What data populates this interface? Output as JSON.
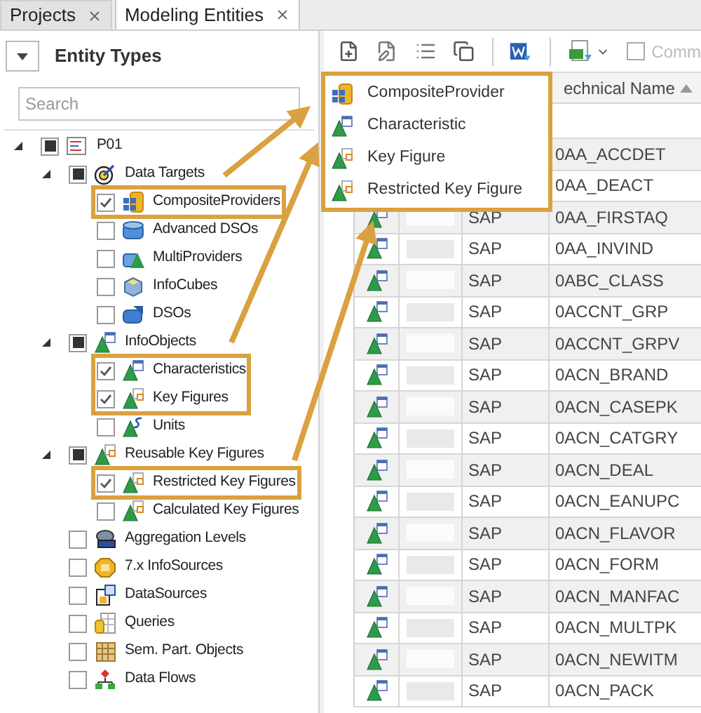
{
  "tabs": [
    {
      "label": "Projects",
      "selected": false
    },
    {
      "label": "Modeling Entities",
      "selected": true
    }
  ],
  "entity_panel": {
    "title": "Entity Types",
    "search": {
      "placeholder": "Search"
    }
  },
  "tree": [
    {
      "label": "P01",
      "kind": "project",
      "checked": false,
      "partial": true,
      "expanded": true,
      "highlighted": false,
      "children": [
        {
          "label": "Data Targets",
          "kind": "targets",
          "checked": false,
          "partial": true,
          "expanded": true,
          "highlighted": false,
          "children": [
            {
              "label": "CompositeProviders",
              "kind": "composite",
              "checked": true,
              "partial": false,
              "highlighted": true
            },
            {
              "label": "Advanced DSOs",
              "kind": "cylinder",
              "checked": false,
              "partial": false,
              "highlighted": false
            },
            {
              "label": "MultiProviders",
              "kind": "multi",
              "checked": false,
              "partial": false,
              "highlighted": false
            },
            {
              "label": "InfoCubes",
              "kind": "cube",
              "checked": false,
              "partial": false,
              "highlighted": false
            },
            {
              "label": "DSOs",
              "kind": "dso",
              "checked": false,
              "partial": false,
              "highlighted": false
            }
          ]
        },
        {
          "label": "InfoObjects",
          "kind": "characteristic",
          "checked": false,
          "partial": true,
          "expanded": true,
          "highlighted": false,
          "children": [
            {
              "label": "Characteristics",
              "kind": "characteristic",
              "checked": true,
              "partial": false,
              "highlighted": true
            },
            {
              "label": "Key Figures",
              "kind": "keyfigure",
              "checked": true,
              "partial": false,
              "highlighted": true
            },
            {
              "label": "Units",
              "kind": "unit",
              "checked": false,
              "partial": false,
              "highlighted": false
            }
          ]
        },
        {
          "label": "Reusable Key Figures",
          "kind": "keyfigure",
          "checked": false,
          "partial": true,
          "expanded": true,
          "highlighted": false,
          "children": [
            {
              "label": "Restricted Key Figures",
              "kind": "keyfigure",
              "checked": true,
              "partial": false,
              "highlighted": true
            },
            {
              "label": "Calculated Key Figures",
              "kind": "calculated",
              "checked": false,
              "partial": false,
              "highlighted": false
            }
          ]
        },
        {
          "label": "Aggregation Levels",
          "kind": "aggregation",
          "checked": false,
          "partial": false,
          "highlighted": false
        },
        {
          "label": "7.x InfoSources",
          "kind": "infosource",
          "checked": false,
          "partial": false,
          "highlighted": false
        },
        {
          "label": "DataSources",
          "kind": "datasource",
          "checked": false,
          "partial": false,
          "highlighted": false
        },
        {
          "label": "Queries",
          "kind": "query",
          "checked": false,
          "partial": false,
          "highlighted": false
        },
        {
          "label": "Sem. Part. Objects",
          "kind": "sempart",
          "checked": false,
          "partial": false,
          "highlighted": false
        },
        {
          "label": "Data Flows",
          "kind": "dataflow",
          "checked": false,
          "partial": false,
          "highlighted": false
        }
      ]
    }
  ],
  "toolbar": {
    "checkbox": {
      "label": "Comm",
      "checked": false
    }
  },
  "popup_menu": {
    "items": [
      {
        "label": "CompositeProvider",
        "kind": "composite"
      },
      {
        "label": "Characteristic",
        "kind": "characteristic"
      },
      {
        "label": "Key Figure",
        "kind": "keyfigure"
      },
      {
        "label": "Restricted Key Figure",
        "kind": "keyfigure"
      }
    ]
  },
  "table": {
    "columns": [
      {
        "label": "echnical Name",
        "sorted": true
      }
    ],
    "rows": [
      {
        "name": "0AA_ACCDET"
      },
      {
        "name": "0AA_DEACT"
      },
      {
        "owner": "SAP",
        "name": "0AA_FIRSTAQ"
      },
      {
        "owner": "SAP",
        "name": "0AA_INVIND"
      },
      {
        "owner": "SAP",
        "name": "0ABC_CLASS"
      },
      {
        "owner": "SAP",
        "name": "0ACCNT_GRP"
      },
      {
        "owner": "SAP",
        "name": "0ACCNT_GRPV"
      },
      {
        "owner": "SAP",
        "name": "0ACN_BRAND"
      },
      {
        "owner": "SAP",
        "name": "0ACN_CASEPK"
      },
      {
        "owner": "SAP",
        "name": "0ACN_CATGRY"
      },
      {
        "owner": "SAP",
        "name": "0ACN_DEAL"
      },
      {
        "owner": "SAP",
        "name": "0ACN_EANUPC"
      },
      {
        "owner": "SAP",
        "name": "0ACN_FLAVOR"
      },
      {
        "owner": "SAP",
        "name": "0ACN_FORM"
      },
      {
        "owner": "SAP",
        "name": "0ACN_MANFAC"
      },
      {
        "owner": "SAP",
        "name": "0ACN_MULTPK"
      },
      {
        "owner": "SAP",
        "name": "0ACN_NEWITM"
      },
      {
        "owner": "SAP",
        "name": "0ACN_PACK"
      }
    ]
  }
}
